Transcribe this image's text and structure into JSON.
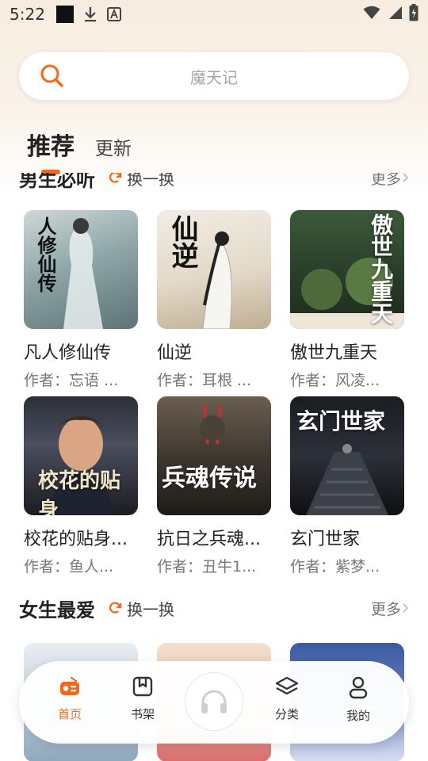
{
  "status_bar": {
    "time": "5:22"
  },
  "search": {
    "placeholder": "魔天记"
  },
  "tabs": [
    {
      "label": "推荐",
      "active": true
    },
    {
      "label": "更新",
      "active": false
    }
  ],
  "sections": [
    {
      "title": "男生必听",
      "refresh_label": "换一换",
      "more_label": "更多",
      "books": [
        {
          "title": "凡人修仙传",
          "author": "作者：忘语 ...",
          "cover_text": "人修仙传"
        },
        {
          "title": "仙逆",
          "author": "作者：耳根 ...",
          "cover_text": "仙逆"
        },
        {
          "title": "傲世九重天",
          "author": "作者：风凌...",
          "cover_text": "傲世九重天"
        },
        {
          "title": "校花的贴身...",
          "author": "作者：鱼人...",
          "cover_text": "校花的贴身"
        },
        {
          "title": "抗日之兵魂...",
          "author": "作者：丑牛1...",
          "cover_text": "兵魂传说"
        },
        {
          "title": "玄门世家",
          "author": "作者：紫梦...",
          "cover_text": "玄门世家"
        }
      ]
    },
    {
      "title": "女生最爱",
      "refresh_label": "换一换",
      "more_label": "更多",
      "books": [
        {
          "title": "",
          "author": ""
        },
        {
          "title": "",
          "author": ""
        },
        {
          "title": "",
          "author": ""
        }
      ]
    }
  ],
  "bottom_nav": [
    {
      "label": "首页",
      "icon": "radio-icon",
      "active": true
    },
    {
      "label": "书架",
      "icon": "bookmark-icon",
      "active": false
    },
    {
      "label": "",
      "icon": "headphones-icon",
      "active": false
    },
    {
      "label": "分类",
      "icon": "layers-icon",
      "active": false
    },
    {
      "label": "我的",
      "icon": "user-icon",
      "active": false
    }
  ],
  "colors": {
    "accent": "#f2681c",
    "background_top": "#f7ecdf"
  }
}
